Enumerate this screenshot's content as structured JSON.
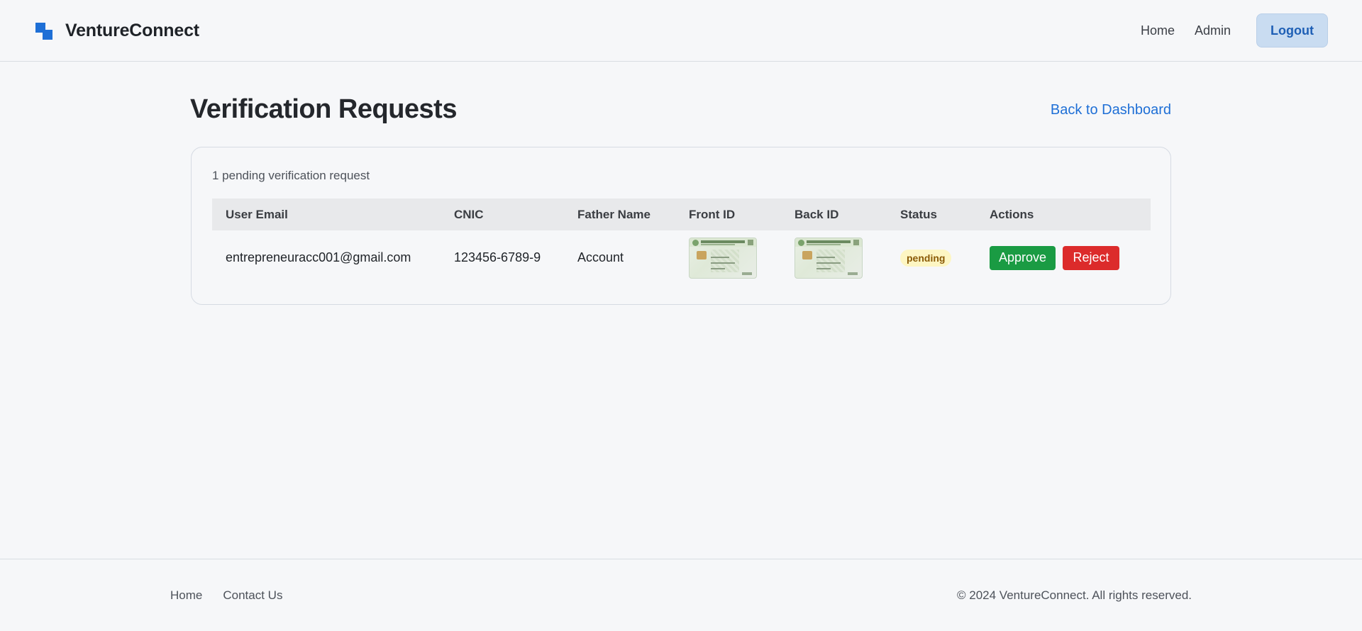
{
  "header": {
    "brand_name": "VentureConnect",
    "nav": {
      "home": "Home",
      "admin": "Admin",
      "logout": "Logout"
    }
  },
  "main": {
    "title": "Verification Requests",
    "back_link": "Back to Dashboard",
    "pending_count_text": "1 pending verification request",
    "table": {
      "columns": [
        "User Email",
        "CNIC",
        "Father Name",
        "Front ID",
        "Back ID",
        "Status",
        "Actions"
      ],
      "rows": [
        {
          "email": "entrepreneuracc001@gmail.com",
          "cnic": "123456-6789-9",
          "father_name": "Account",
          "status": "pending",
          "approve_label": "Approve",
          "reject_label": "Reject"
        }
      ]
    }
  },
  "footer": {
    "links": {
      "home": "Home",
      "contact": "Contact Us"
    },
    "copyright": "© 2024 VentureConnect. All rights reserved."
  },
  "colors": {
    "accent": "#1e6fd6",
    "approve": "#1a9b43",
    "reject": "#dc2b2b",
    "pending_badge_bg": "#fdf6c3",
    "pending_badge_text": "#8a5a06"
  }
}
